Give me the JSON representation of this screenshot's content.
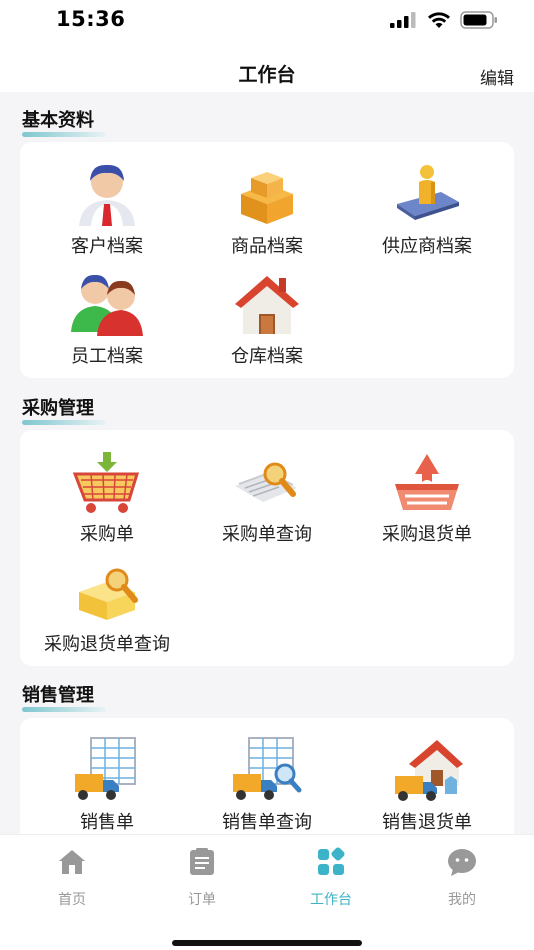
{
  "status_bar": {
    "time": "15:36"
  },
  "nav": {
    "title": "工作台",
    "edit_label": "编辑"
  },
  "sections": [
    {
      "title": "基本资料",
      "items": [
        {
          "label": "客户档案",
          "icon": "customer-icon"
        },
        {
          "label": "商品档案",
          "icon": "goods-icon"
        },
        {
          "label": "供应商档案",
          "icon": "supplier-icon"
        },
        {
          "label": "员工档案",
          "icon": "employee-icon"
        },
        {
          "label": "仓库档案",
          "icon": "warehouse-icon"
        }
      ]
    },
    {
      "title": "采购管理",
      "items": [
        {
          "label": "采购单",
          "icon": "purchase-cart-icon"
        },
        {
          "label": "采购单查询",
          "icon": "purchase-query-icon"
        },
        {
          "label": "采购退货单",
          "icon": "purchase-return-icon"
        },
        {
          "label": "采购退货单查询",
          "icon": "purchase-return-query-icon"
        }
      ]
    },
    {
      "title": "销售管理",
      "items": [
        {
          "label": "销售单",
          "icon": "sales-order-icon"
        },
        {
          "label": "销售单查询",
          "icon": "sales-query-icon"
        },
        {
          "label": "销售退货单",
          "icon": "sales-return-icon"
        }
      ]
    }
  ],
  "tabs": [
    {
      "label": "首页",
      "icon": "home-icon"
    },
    {
      "label": "订单",
      "icon": "order-icon"
    },
    {
      "label": "工作台",
      "icon": "workbench-icon",
      "active": true
    },
    {
      "label": "我的",
      "icon": "profile-icon"
    }
  ],
  "colors": {
    "accent": "#3cb3c8",
    "inactive": "#999999"
  }
}
